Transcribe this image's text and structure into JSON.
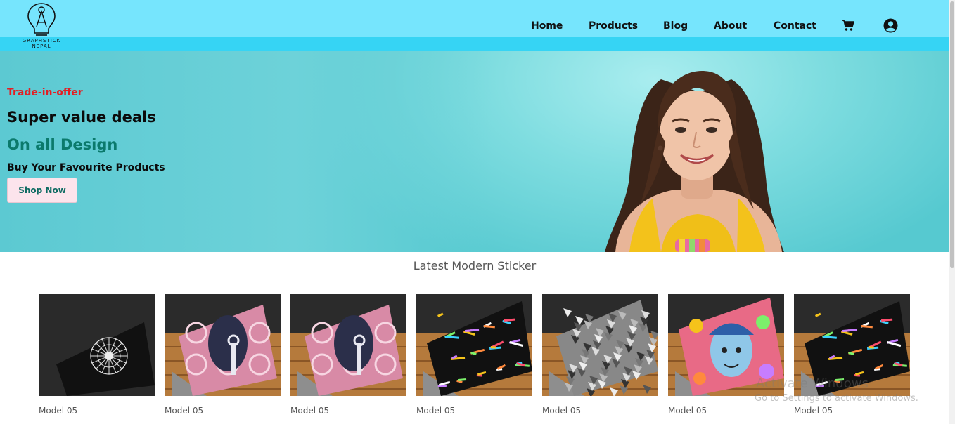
{
  "brand": {
    "logo_text_line1": "GRAPHSTICK",
    "logo_text_line2": "NEPAL"
  },
  "nav": {
    "items": [
      "Home",
      "Products",
      "Blog",
      "About",
      "Contact"
    ],
    "cart_icon": "cart-icon",
    "account_icon": "user-circle-icon"
  },
  "hero": {
    "offer": "Trade-in-offer",
    "title": "Super value deals",
    "subtitle": "On all Design",
    "tagline": "Buy Your Favourite Products",
    "button": "Shop Now"
  },
  "section": {
    "title": "Latest Modern Sticker",
    "products": [
      {
        "label": "Model 05",
        "design": "mandala"
      },
      {
        "label": "Model 05",
        "design": "floral-figure"
      },
      {
        "label": "Model 05",
        "design": "floral-figure"
      },
      {
        "label": "Model 05",
        "design": "graffiti"
      },
      {
        "label": "Model 05",
        "design": "mosaic"
      },
      {
        "label": "Model 05",
        "design": "cartoon"
      },
      {
        "label": "Model 05",
        "design": "graffiti"
      }
    ]
  },
  "os_watermark": {
    "line1": "Activate Windows",
    "line2": "Go to Settings to activate Windows."
  },
  "colors": {
    "header": "#76e5fd",
    "header_band": "#36d4f4",
    "offer": "#e31e24",
    "subtitle": "#0b7a6c",
    "button_bg": "#fce4ec"
  }
}
